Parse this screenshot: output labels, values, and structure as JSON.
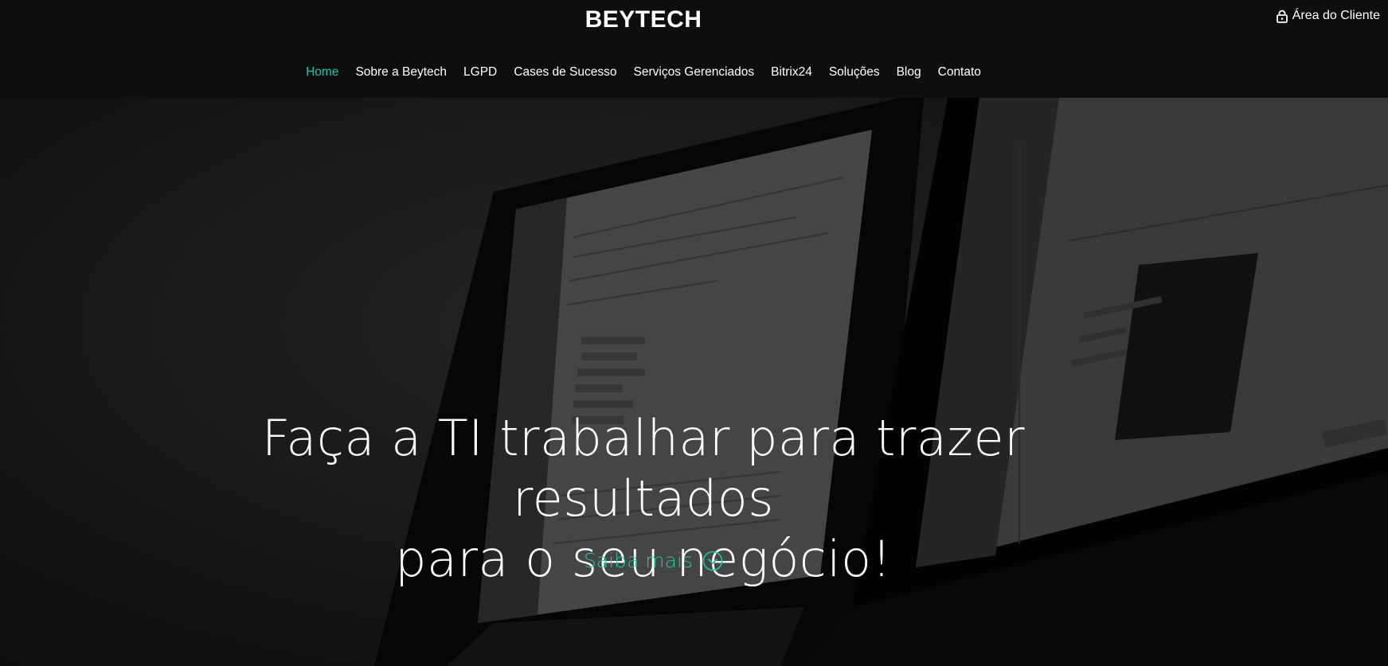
{
  "brand": {
    "logo": "BEYTECH",
    "accent": "#1ec6a4"
  },
  "header": {
    "client_area": "Área do Cliente",
    "client_icon": "lock-icon"
  },
  "nav": {
    "items": [
      {
        "label": "Home",
        "active": true
      },
      {
        "label": "Sobre a Beytech"
      },
      {
        "label": "LGPD"
      },
      {
        "label": "Cases de Sucesso"
      },
      {
        "label": "Serviços Gerenciados"
      },
      {
        "label": "Bitrix24"
      },
      {
        "label": "Soluções"
      },
      {
        "label": "Blog"
      },
      {
        "label": "Contato"
      }
    ]
  },
  "hero": {
    "title_line1": "Faça a TI trabalhar para trazer resultados",
    "title_line2": "para o seu negócio!",
    "cta_label": "Saiba mais",
    "cta_icon": "chevron-down-circle-icon",
    "background": "monitors-dashboard-image"
  }
}
